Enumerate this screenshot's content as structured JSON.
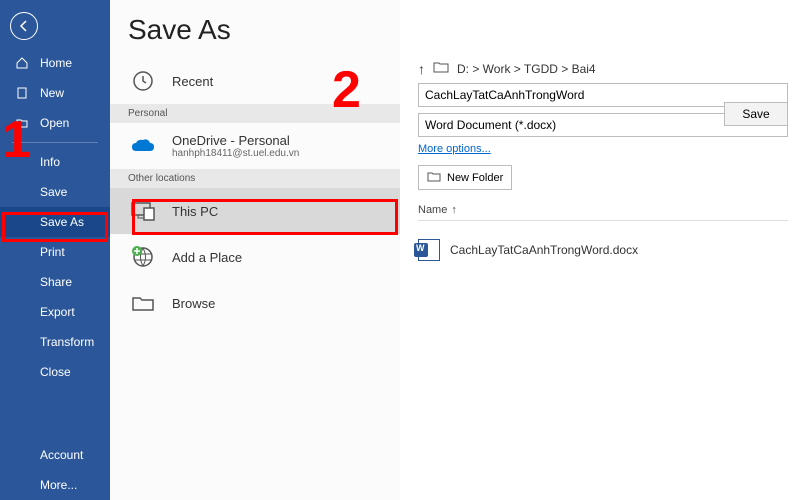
{
  "sidebar": {
    "items": [
      {
        "label": "Home"
      },
      {
        "label": "New"
      },
      {
        "label": "Open"
      },
      {
        "label": "Info"
      },
      {
        "label": "Save"
      },
      {
        "label": "Save As"
      },
      {
        "label": "Print"
      },
      {
        "label": "Share"
      },
      {
        "label": "Export"
      },
      {
        "label": "Transform"
      },
      {
        "label": "Close"
      },
      {
        "label": "Account"
      },
      {
        "label": "More..."
      }
    ]
  },
  "page": {
    "title": "Save As"
  },
  "locations": {
    "recent": "Recent",
    "header1": "Personal",
    "onedrive": {
      "title": "OneDrive - Personal",
      "sub": "hanhph18411@st.uel.edu.vn"
    },
    "header2": "Other locations",
    "thispc": "This PC",
    "addplace": "Add a Place",
    "browse": "Browse"
  },
  "right": {
    "breadcrumb": "D: > Work > TGDD > Bai4",
    "filename": "CachLayTatCaAnhTrongWord",
    "filetype": "Word Document (*.docx)",
    "more": "More options...",
    "newfolder": "New Folder",
    "colName": "Name",
    "fileEntry": "CachLayTatCaAnhTrongWord.docx",
    "saveLabel": "Save"
  },
  "annotations": {
    "n1": "1",
    "n2": "2"
  }
}
